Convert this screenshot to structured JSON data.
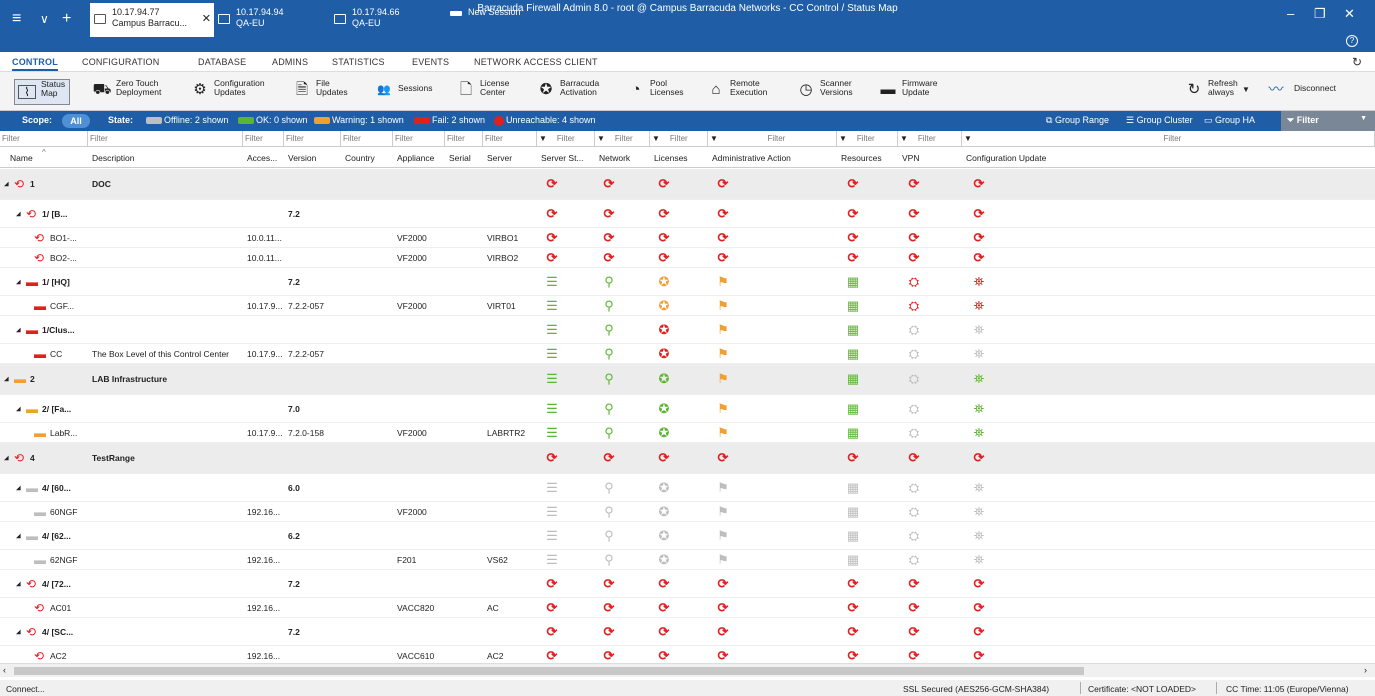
{
  "window_title": "Barracuda Firewall Admin 8.0  -  root @ Campus Barracuda Networks  -  CC Control / Status Map",
  "sessions": [
    {
      "line1": "10.17.94.77",
      "line2": "Campus Barracu..."
    },
    {
      "line1": "10.17.94.94",
      "line2": "QA-EU"
    },
    {
      "line1": "10.17.94.66",
      "line2": "QA-EU"
    },
    {
      "line1": "New Session",
      "line2": ""
    }
  ],
  "window_controls": {
    "minimize": "–",
    "restore": "❐",
    "close": "✕",
    "help": "?"
  },
  "menu": [
    "CONTROL",
    "CONFIGURATION",
    "DATABASE",
    "ADMINS",
    "STATISTICS",
    "EVENTS",
    "NETWORK ACCESS CLIENT"
  ],
  "toolbar": [
    {
      "l1": "Status",
      "l2": "Map",
      "icon": "status-map-icon"
    },
    {
      "l1": "Zero Touch",
      "l2": "Deployment",
      "icon": "zero-touch-icon"
    },
    {
      "l1": "Configuration",
      "l2": "Updates",
      "icon": "configuration-updates-icon"
    },
    {
      "l1": "File",
      "l2": "Updates",
      "icon": "file-updates-icon"
    },
    {
      "l1": "Sessions",
      "l2": "",
      "icon": "sessions-icon"
    },
    {
      "l1": "License",
      "l2": "Center",
      "icon": "license-center-icon"
    },
    {
      "l1": "Barracuda",
      "l2": "Activation",
      "icon": "activation-icon"
    },
    {
      "l1": "Pool",
      "l2": "Licenses",
      "icon": "pool-licenses-icon"
    },
    {
      "l1": "Remote",
      "l2": "Execution",
      "icon": "remote-execution-icon"
    },
    {
      "l1": "Scanner",
      "l2": "Versions",
      "icon": "scanner-versions-icon"
    },
    {
      "l1": "Firmware",
      "l2": "Update",
      "icon": "firmware-update-icon"
    },
    {
      "l1": "Refresh",
      "l2": "always",
      "icon": "refresh-icon"
    },
    {
      "l1": "Disconnect",
      "l2": "",
      "icon": "disconnect-icon"
    }
  ],
  "filterbar": {
    "scope_label": "Scope:",
    "scope_value": "All",
    "state_label": "State:",
    "states": [
      {
        "text": "Offline: 2 shown",
        "color": "#bfbfbf"
      },
      {
        "text": "OK: 0 shown",
        "color": "#5cb531"
      },
      {
        "text": "Warning: 1 shown",
        "color": "#f0a030"
      },
      {
        "text": "Fail: 2 shown",
        "color": "#e02020"
      },
      {
        "text": "Unreachable: 4 shown",
        "color": "#e02020"
      }
    ],
    "group_range": "Group Range",
    "group_cluster": "Group Cluster",
    "group_ha": "Group HA",
    "filter_button": "Filter"
  },
  "filter_placeholder": "Filter",
  "columns": [
    "Name",
    "Description",
    "Acces...",
    "Version",
    "Country",
    "Appliance",
    "Serial",
    "Server",
    "Server St...",
    "Network",
    "Licenses",
    "Administrative Action",
    "Resources",
    "VPN",
    "Configuration Update"
  ],
  "colors": {
    "unreachable": "#e02020",
    "ok": "#5cb531",
    "warning": "#f0a030",
    "fail": "#e02020",
    "offline": "#bdbdbd",
    "brand": "#1f5ea7"
  },
  "rows": [
    {
      "kind": "group",
      "name": "1",
      "desc": "DOC",
      "ver": "",
      "acc": "",
      "app": "",
      "srv": "",
      "icon": "u",
      "st": [
        "u",
        "u",
        "u",
        "u",
        "u",
        "u",
        "u"
      ]
    },
    {
      "kind": "sub",
      "name": "1/ [B...",
      "desc": "",
      "ver": "7.2",
      "acc": "",
      "app": "",
      "srv": "",
      "icon": "u",
      "st": [
        "u",
        "u",
        "u",
        "u",
        "u",
        "u",
        "u"
      ]
    },
    {
      "kind": "box",
      "name": "BO1-...",
      "desc": "",
      "ver": "",
      "acc": "10.0.11...",
      "app": "VF2000",
      "srv": "VIRBO1",
      "icon": "u",
      "st": [
        "u",
        "u",
        "u",
        "u",
        "u",
        "u",
        "u"
      ]
    },
    {
      "kind": "box",
      "name": "BO2-...",
      "desc": "",
      "ver": "",
      "acc": "10.0.11...",
      "app": "VF2000",
      "srv": "VIRBO2",
      "icon": "u",
      "st": [
        "u",
        "u",
        "u",
        "u",
        "u",
        "u",
        "u"
      ]
    },
    {
      "kind": "sub",
      "name": "1/ [HQ]",
      "desc": "",
      "ver": "7.2",
      "acc": "",
      "app": "",
      "srv": "",
      "icon": "f",
      "st": [
        "ok",
        "ok",
        "w",
        "w",
        "ok",
        "f",
        "f"
      ]
    },
    {
      "kind": "box",
      "name": "CGF...",
      "desc": "",
      "ver": "7.2.2-057",
      "acc": "10.17.9...",
      "app": "VF2000",
      "srv": "VIRT01",
      "icon": "f",
      "st": [
        "ok",
        "ok",
        "w",
        "w",
        "ok",
        "f",
        "f"
      ]
    },
    {
      "kind": "sub",
      "name": "1/Clus...",
      "desc": "",
      "ver": "",
      "acc": "",
      "app": "",
      "srv": "",
      "icon": "f",
      "st": [
        "ok",
        "ok",
        "f",
        "w",
        "ok",
        "o",
        "o"
      ]
    },
    {
      "kind": "box",
      "name": "CC",
      "desc": "The Box Level of this Control Center",
      "ver": "7.2.2-057",
      "acc": "10.17.9...",
      "app": "",
      "srv": "",
      "icon": "f",
      "st": [
        "ok",
        "ok",
        "f",
        "w",
        "ok",
        "o",
        "o"
      ]
    },
    {
      "kind": "group",
      "name": "2",
      "desc": "LAB Infrastructure",
      "ver": "",
      "acc": "",
      "app": "",
      "srv": "",
      "icon": "w",
      "st": [
        "ok",
        "ok",
        "ok",
        "w",
        "ok",
        "o",
        "ok"
      ]
    },
    {
      "kind": "sub",
      "name": "2/ [Fa...",
      "desc": "",
      "ver": "7.0",
      "acc": "",
      "app": "",
      "srv": "",
      "icon": "w",
      "st": [
        "ok",
        "ok",
        "ok",
        "w",
        "ok",
        "o",
        "ok"
      ]
    },
    {
      "kind": "box",
      "name": "LabR...",
      "desc": "",
      "ver": "7.2.0-158",
      "acc": "10.17.9...",
      "app": "VF2000",
      "srv": "LABRTR2",
      "icon": "w",
      "st": [
        "ok",
        "ok",
        "ok",
        "w",
        "ok",
        "o",
        "ok"
      ]
    },
    {
      "kind": "group",
      "name": "4",
      "desc": "TestRange",
      "ver": "",
      "acc": "",
      "app": "",
      "srv": "",
      "icon": "u",
      "st": [
        "u",
        "u",
        "u",
        "u",
        "u",
        "u",
        "u"
      ]
    },
    {
      "kind": "sub",
      "name": "4/ [60...",
      "desc": "",
      "ver": "6.0",
      "acc": "",
      "app": "",
      "srv": "",
      "icon": "o",
      "st": [
        "o",
        "o",
        "o",
        "o",
        "o",
        "o",
        "o"
      ]
    },
    {
      "kind": "box",
      "name": "60NGF",
      "desc": "",
      "ver": "",
      "acc": "192.16...",
      "app": "VF2000",
      "srv": "",
      "icon": "o",
      "st": [
        "o",
        "o",
        "o",
        "o",
        "o",
        "o",
        "o"
      ]
    },
    {
      "kind": "sub",
      "name": "4/ [62...",
      "desc": "",
      "ver": "6.2",
      "acc": "",
      "app": "",
      "srv": "",
      "icon": "o",
      "st": [
        "o",
        "o",
        "o",
        "o",
        "o",
        "o",
        "o"
      ]
    },
    {
      "kind": "box",
      "name": "62NGF",
      "desc": "",
      "ver": "",
      "acc": "192.16...",
      "app": "F201",
      "srv": "VS62",
      "icon": "o",
      "st": [
        "o",
        "o",
        "o",
        "o",
        "o",
        "o",
        "o"
      ]
    },
    {
      "kind": "sub",
      "name": "4/ [72...",
      "desc": "",
      "ver": "7.2",
      "acc": "",
      "app": "",
      "srv": "",
      "icon": "u",
      "st": [
        "u",
        "u",
        "u",
        "u",
        "u",
        "u",
        "u"
      ]
    },
    {
      "kind": "box",
      "name": "AC01",
      "desc": "",
      "ver": "",
      "acc": "192.16...",
      "app": "VACC820",
      "srv": "AC",
      "icon": "u",
      "st": [
        "u",
        "u",
        "u",
        "u",
        "u",
        "u",
        "u"
      ]
    },
    {
      "kind": "sub",
      "name": "4/ [SC...",
      "desc": "",
      "ver": "7.2",
      "acc": "",
      "app": "",
      "srv": "",
      "icon": "u",
      "st": [
        "u",
        "u",
        "u",
        "u",
        "u",
        "u",
        "u"
      ]
    },
    {
      "kind": "box",
      "name": "AC2",
      "desc": "",
      "ver": "",
      "acc": "192.16...",
      "app": "VACC610",
      "srv": "AC2",
      "icon": "u",
      "st": [
        "u",
        "u",
        "u",
        "u",
        "u",
        "u",
        "u"
      ]
    }
  ],
  "status": {
    "left": "Connect...",
    "ssl": "SSL Secured (AES256-GCM-SHA384)",
    "cert": "Certificate: <NOT LOADED>",
    "time": "CC Time: 11:05 (Europe/Vienna)"
  }
}
